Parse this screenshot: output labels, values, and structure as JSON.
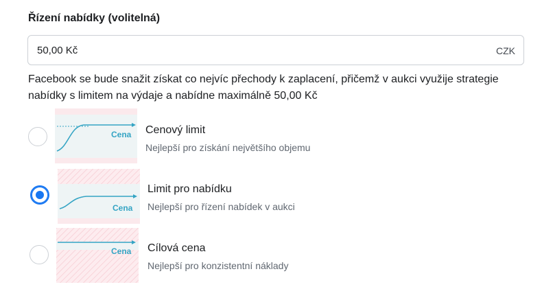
{
  "section": {
    "title": "Řízení nabídky (volitelná)"
  },
  "bid": {
    "value": "50,00 Kč",
    "currency": "CZK"
  },
  "description": "Facebook se bude snažit získat co nejvíc přechody k zaplacení, přičemž v aukci využije strategie nabídky s limitem na výdaje a nabídne maximálně 50,00 Kč",
  "options": [
    {
      "title": "Cenový limit",
      "subtitle": "Nejlepší pro získání největšího objemu",
      "graph_label": "Cena",
      "selected": false
    },
    {
      "title": "Limit pro nabídku",
      "subtitle": "Nejlepší pro řízení nabídek v aukci",
      "graph_label": "Cena",
      "selected": true
    },
    {
      "title": "Cílová cena",
      "subtitle": "Nejlepší pro konzistentní náklady",
      "graph_label": "Cena",
      "selected": false
    }
  ],
  "colors": {
    "accent": "#1877f2",
    "graph_line": "#34a4c4",
    "graph_bg": "#eef4f5",
    "hatch": "#fde3e6"
  }
}
